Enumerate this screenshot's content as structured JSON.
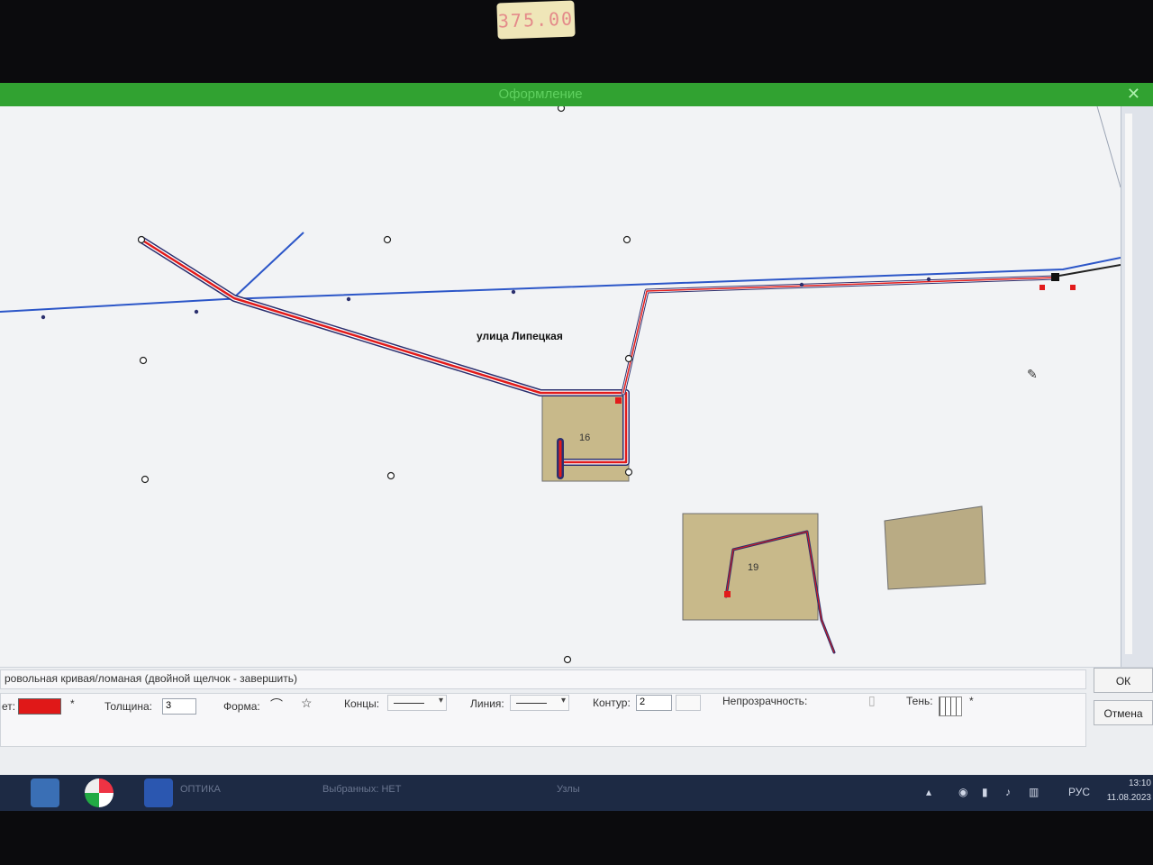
{
  "window": {
    "title": "Оформление",
    "close_label": "✕"
  },
  "sticker": {
    "text": "375.00"
  },
  "map": {
    "street_label": "улица Липецкая",
    "plots": [
      {
        "number": "16"
      },
      {
        "number": "19"
      }
    ],
    "colors": {
      "pipe_red": "#e21b1b",
      "pipe_outline": "#2b2f6e",
      "street_blue": "#2c56c8",
      "plot_fill": "#c8b98a"
    }
  },
  "toolpanel": {
    "hint": "ровольная кривая/ломаная (двойной щелчок - завершить)",
    "color_label": "ет:",
    "color_value": "#e01818",
    "color_asterisk": "*",
    "thickness_label": "Толщина:",
    "thickness_value": "3",
    "shape_label": "Форма:",
    "ends_label": "Концы:",
    "line_label": "Линия:",
    "contour_label": "Контур:",
    "contour_value": "2",
    "opacity_label": "Непрозрачность:",
    "shadow_label": "Тень:",
    "shadow_asterisk": "*",
    "ok_label": "ОК",
    "cancel_label": "Отмена"
  },
  "statusbar": {
    "layer_text": "ОПТИКА",
    "selected_text": "Выбранных: НЕТ",
    "nodes_text": "Узлы",
    "lang": "РУС",
    "time": "13:10",
    "date": "11.08.2023"
  }
}
